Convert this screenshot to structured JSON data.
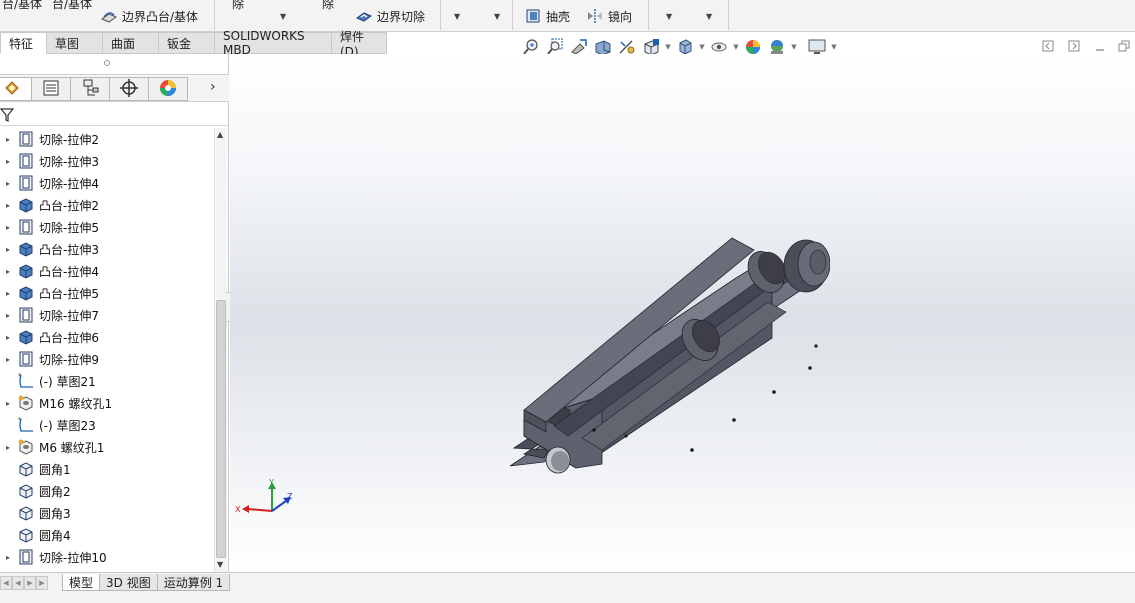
{
  "ribbon": {
    "cut_text_1": "台/基体",
    "cut_text_2": "台/基体",
    "boundary_boss": "边界凸台/基体",
    "cut_text_3": "除",
    "cut_text_4": "除",
    "boundary_cut": "边界切除",
    "shell": "抽壳",
    "mirror": "镜向"
  },
  "command_tabs": [
    {
      "label": "特征",
      "active": true
    },
    {
      "label": "草图"
    },
    {
      "label": "曲面"
    },
    {
      "label": "钣金"
    },
    {
      "label": "SOLIDWORKS MBD"
    },
    {
      "label": "焊件(D)"
    }
  ],
  "view_toolbar_icons": [
    "zoom-to-fit-icon",
    "zoom-to-area-icon",
    "previous-view-icon",
    "section-view-icon",
    "dynamic-annotation-icon",
    "view-orientation-icon",
    "display-style-icon",
    "hide-show-icon",
    "edit-appearance-icon",
    "apply-scene-icon",
    "view-settings-icon"
  ],
  "manager_tabs": [
    "feature-manager-icon",
    "property-manager-icon",
    "configuration-manager-icon",
    "dimxpert-manager-icon",
    "display-manager-icon"
  ],
  "tree": [
    {
      "label": "切除-拉伸2",
      "type": "cut"
    },
    {
      "label": "切除-拉伸3",
      "type": "cut"
    },
    {
      "label": "切除-拉伸4",
      "type": "cut"
    },
    {
      "label": "凸台-拉伸2",
      "type": "boss"
    },
    {
      "label": "切除-拉伸5",
      "type": "cut"
    },
    {
      "label": "凸台-拉伸3",
      "type": "boss"
    },
    {
      "label": "凸台-拉伸4",
      "type": "boss"
    },
    {
      "label": "凸台-拉伸5",
      "type": "boss"
    },
    {
      "label": "切除-拉伸7",
      "type": "cut"
    },
    {
      "label": "凸台-拉伸6",
      "type": "boss"
    },
    {
      "label": "切除-拉伸9",
      "type": "cut"
    },
    {
      "label": "(-) 草图21",
      "type": "sketch"
    },
    {
      "label": "M16 螺纹孔1",
      "type": "hole"
    },
    {
      "label": "(-) 草图23",
      "type": "sketch"
    },
    {
      "label": "M6 螺纹孔1",
      "type": "hole"
    },
    {
      "label": "圆角1",
      "type": "fillet"
    },
    {
      "label": "圆角2",
      "type": "fillet"
    },
    {
      "label": "圆角3",
      "type": "fillet"
    },
    {
      "label": "圆角4",
      "type": "fillet"
    },
    {
      "label": "切除-拉伸10",
      "type": "cut"
    }
  ],
  "triad": {
    "x": "X",
    "y": "Y",
    "z": "Z"
  },
  "bottom_tabs": [
    {
      "label": "模型",
      "active": true
    },
    {
      "label": "3D 视图"
    },
    {
      "label": "运动算例 1"
    }
  ],
  "colors": {
    "accent": "#1f5fb0",
    "model": "#5d5f6d",
    "model_dark": "#3a3b46",
    "model_light": "#7a7c8a"
  }
}
